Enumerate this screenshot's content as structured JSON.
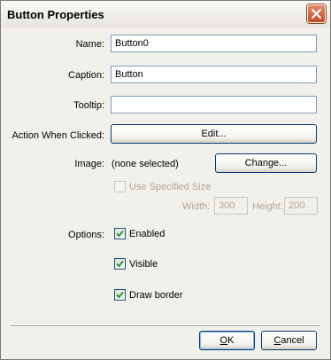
{
  "window": {
    "title": "Button Properties",
    "close_icon": "close-icon",
    "close_color": "#c44a23"
  },
  "fields": {
    "name": {
      "label": "Name:",
      "value": "Button0"
    },
    "caption": {
      "label": "Caption:",
      "value": "Button"
    },
    "tooltip": {
      "label": "Tooltip:",
      "value": ""
    }
  },
  "action": {
    "label": "Action When Clicked:",
    "button": "Edit..."
  },
  "image": {
    "label": "Image:",
    "value": "(none selected)",
    "button": "Change..."
  },
  "size": {
    "checkbox_label": "Use Specified Size",
    "checked": false,
    "width_label": "Width:",
    "width_value": "300",
    "height_label": "Height:",
    "height_value": "200"
  },
  "options": {
    "label": "Options:",
    "items": [
      {
        "label": "Enabled",
        "checked": true
      },
      {
        "label": "Visible",
        "checked": true
      },
      {
        "label": "Draw border",
        "checked": true
      }
    ]
  },
  "footer": {
    "ok_prefix": "",
    "ok_mnemonic": "O",
    "ok_rest": "K",
    "cancel_prefix": "",
    "cancel_mnemonic": "C",
    "cancel_rest": "ancel"
  },
  "colors": {
    "check": "#21a121",
    "border": "#7f9db9"
  }
}
